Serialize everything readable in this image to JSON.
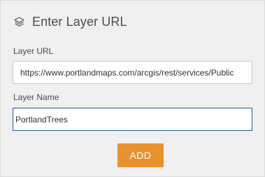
{
  "header": {
    "title": "Enter Layer URL",
    "icon": "layers-icon"
  },
  "layer_url": {
    "label": "Layer URL",
    "value": "https://www.portlandmaps.com/arcgis/rest/services/Public"
  },
  "layer_name": {
    "label": "Layer Name",
    "value": "PortlandTrees"
  },
  "actions": {
    "add_label": "ADD"
  },
  "colors": {
    "panel_background": "#f0f0f0",
    "add_button": "#e8922e",
    "focused_border": "#1f5c99"
  }
}
